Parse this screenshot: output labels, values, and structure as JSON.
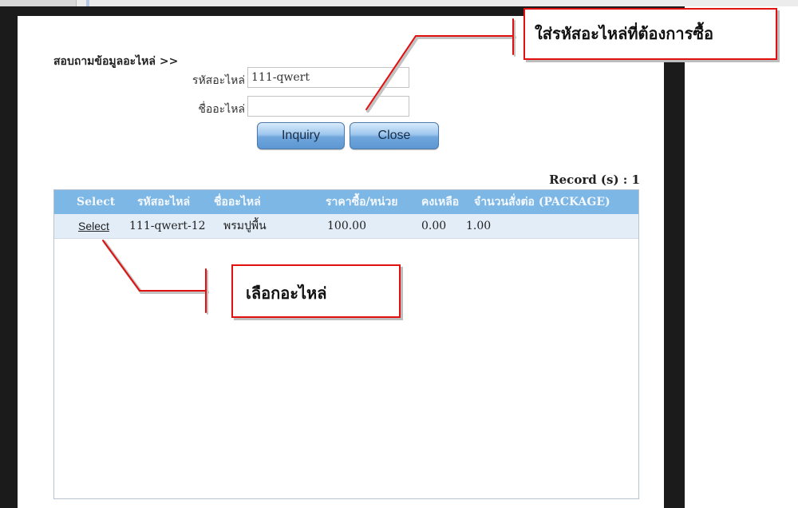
{
  "form": {
    "section_title": "สอบถามข้อมูลอะไหล่ >>",
    "part_code_label": "รหัสอะไหล่",
    "part_code_value": "111-qwert",
    "part_name_label": "ชื่ออะไหล่",
    "part_name_value": "",
    "inquiry_label": "Inquiry",
    "close_label": "Close"
  },
  "results": {
    "record_count": "Record (s) : 1",
    "columns": [
      "Select",
      "รหัสอะไหล่",
      "ชื่ออะไหล่",
      "ราคาซื้อ/หน่วย",
      "คงเหลือ",
      "จำนวนสั่งต่อ (PACKAGE)"
    ],
    "rows": [
      {
        "select": "Select",
        "part_code": "111-qwert-12",
        "part_name": "พรมปูพื้น",
        "price": "100.00",
        "remaining": "0.00",
        "order_qty": "1.00"
      }
    ]
  },
  "annotations": {
    "top_callout": "ใส่รหัสอะไหล่ที่ต้องการซื้อ",
    "bottom_callout": "เลือกอะไหล่"
  },
  "colors": {
    "header_bg": "#7db7e6",
    "row_bg": "#e3edf8",
    "callout_border": "#e31010",
    "button_gradient_mid": "#6fa6dc"
  }
}
